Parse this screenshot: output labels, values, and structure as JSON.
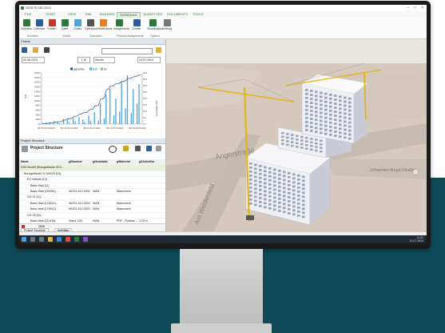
{
  "titlebar": {
    "title": "DESITE MD 2024"
  },
  "ribbon_tabs": [
    "FILE",
    "START",
    "VIEW",
    "BIM",
    "BUILDING",
    "SCHEDULE",
    "QUANTITIES",
    "DOCUMENTS",
    "TOOLS"
  ],
  "active_tab": "SCHEDULE",
  "ribbon_buttons": [
    {
      "label": "Activities",
      "icon": "activities-icon"
    },
    {
      "label": "Calendar",
      "icon": "calendar-icon"
    },
    {
      "label": "Kosten",
      "icon": "costs-icon"
    },
    {
      "label": "Gantt",
      "icon": "gantt-icon"
    },
    {
      "label": "Charts",
      "icon": "charts-icon"
    },
    {
      "label": "Operators",
      "icon": "operators-icon"
    },
    {
      "label": "Restrictions",
      "icon": "restrictions-icon"
    },
    {
      "label": "Assignments",
      "icon": "assignments-icon"
    },
    {
      "label": "Create",
      "icon": "create-icon"
    },
    {
      "label": "Visualization",
      "icon": "visualization-icon"
    },
    {
      "label": "Settings",
      "icon": "settings-icon"
    }
  ],
  "ribbon_groups": [
    "Activities",
    "Charts",
    "Operators",
    "Process Assignments",
    "Options"
  ],
  "charts_panel": {
    "title": "Charts",
    "date_from": "01.08.2023",
    "date_to": "12.07.2024",
    "interval_label": "1 W",
    "mode_label": "Woche"
  },
  "chart_data": {
    "type": "bar",
    "legend": [
      "geplantes",
      "Soll",
      "Ist"
    ],
    "ylabel": "Soll",
    "y2label": "Cumulative Soll",
    "yticks": [
      "2200.0",
      "2000.0",
      "1800.0",
      "1600.0",
      "1400.0",
      "1200.0",
      "1000.0",
      "800.0",
      "600.0",
      "400.0",
      "200.0",
      "0.0"
    ],
    "y2ticks": [
      "40.0",
      "35.0",
      "30.0",
      "25.0",
      "20.0",
      "15.0",
      "10.0",
      "5.0",
      "0.0"
    ],
    "xticks": [
      "WK 36 (02.09.2023)",
      "WK 44 (29.10.2023)",
      "WK 04 (21.01.2024)",
      "WK 14 (07.04.2024)",
      "WK 23 (09.06.2024)"
    ],
    "values": [
      40,
      0,
      60,
      0,
      80,
      0,
      120,
      0,
      60,
      40,
      0,
      220,
      0,
      180,
      60,
      0,
      260,
      120,
      0,
      300,
      0,
      200,
      80,
      0,
      360,
      140,
      0,
      520,
      0,
      160,
      900,
      0,
      240,
      1260,
      0,
      1520,
      0,
      380,
      1100,
      0,
      540,
      1800,
      0,
      680,
      2100,
      0,
      460,
      1500,
      0,
      880,
      1720,
      0
    ],
    "cumulative": [
      0.2,
      0.2,
      0.5,
      0.5,
      0.9,
      0.9,
      1.5,
      1.5,
      1.8,
      2.0,
      2.0,
      3.1,
      3.1,
      4.0,
      4.3,
      4.3,
      5.6,
      6.2,
      6.2,
      7.7,
      7.7,
      8.7,
      9.1,
      9.1,
      10.9,
      11.6,
      11.6,
      14.2,
      14.2,
      15.0,
      19.5,
      19.5,
      20.7,
      27.0,
      27.0,
      29.5,
      29.5,
      30.5,
      31.6,
      31.6,
      32.1,
      33.4,
      33.4,
      34.0,
      35.6,
      35.6,
      36.0,
      37.0,
      37.0,
      37.6,
      38.4,
      38.4
    ]
  },
  "project_structure": {
    "title": "Project Structure",
    "panel_label": "Project Structure",
    "columns": [
      "Name",
      "gfNumber",
      "gfAvailable",
      "gfMaterial",
      "gfUnitsWor"
    ],
    "rows": [
      {
        "indent": 0,
        "name": "DSE Modell (Bürogebäude 02.0...",
        "c1": "",
        "c2": "",
        "c3": "",
        "sel": true
      },
      {
        "indent": 1,
        "name": "Bürogebäude 02 IGW25 [18]",
        "c1": "",
        "c2": "",
        "c3": ""
      },
      {
        "indent": 2,
        "name": "EG Wände [12]",
        "c1": "",
        "c2": "",
        "c3": ""
      },
      {
        "indent": 3,
        "name": "Basic Wall [11]",
        "c1": "",
        "c2": "",
        "c3": ""
      },
      {
        "indent": 3,
        "name": "Basic Wall [194391]...",
        "c1": "WGS1-012.0001",
        "c2": "WAN",
        "c3": "Mauerwerk"
      },
      {
        "indent": 2,
        "name": "OG 01 [11]",
        "c1": "",
        "c2": "",
        "c3": ""
      },
      {
        "indent": 3,
        "name": "Basic Wall [170621]...",
        "c1": "WGS1-012.0002",
        "c2": "WAN",
        "c3": "Mauerwerk"
      },
      {
        "indent": 3,
        "name": "Basic Wall [175512]...",
        "c1": "WGS1-012.0003",
        "c2": "WAN",
        "c3": "Mauerwerk"
      },
      {
        "indent": 2,
        "name": "OG 02 [11]",
        "c1": "",
        "c2": "",
        "c3": ""
      },
      {
        "indent": 3,
        "name": "Basic Wall [211418]",
        "c1": "Wand 12B",
        "c2": "WAN",
        "c3": "PRF - Rohban ...",
        "c4": "1,25 m"
      },
      {
        "indent": 3,
        "name": "Basic Wall [211419]",
        "c1": "Wand 12B",
        "c2": "WAN",
        "c3": "PRF - Rohban ...",
        "c4": "1,25 m"
      },
      {
        "indent": 3,
        "name": "Basic Wall [211420]",
        "c1": "Wand 12B",
        "c2": "WAN",
        "c3": "PRF - Rohban ...",
        "c4": "1,25 m"
      },
      {
        "indent": 3,
        "name": "Basic Wall [211421]",
        "c1": "Wand 12B",
        "c2": "WAN",
        "c3": "PRF - Rohban ...",
        "c4": "1,25 m"
      }
    ],
    "footer_count": "3006",
    "footer_tabs": [
      "Project Structure",
      "Activities"
    ]
  },
  "viewport": {
    "street_labels": [
      "Angerstraße",
      "Am Weidenfeld",
      "Johannes-Ruys-Straße"
    ]
  },
  "taskbar": {
    "time": "11:02",
    "date": "12.07.2024"
  },
  "colors": {
    "accent": "#2d7a3a",
    "teal": "#0e4a57",
    "crane": "#e8b21a",
    "bar": "#4fa3dc",
    "line": "#1f4f8a"
  }
}
